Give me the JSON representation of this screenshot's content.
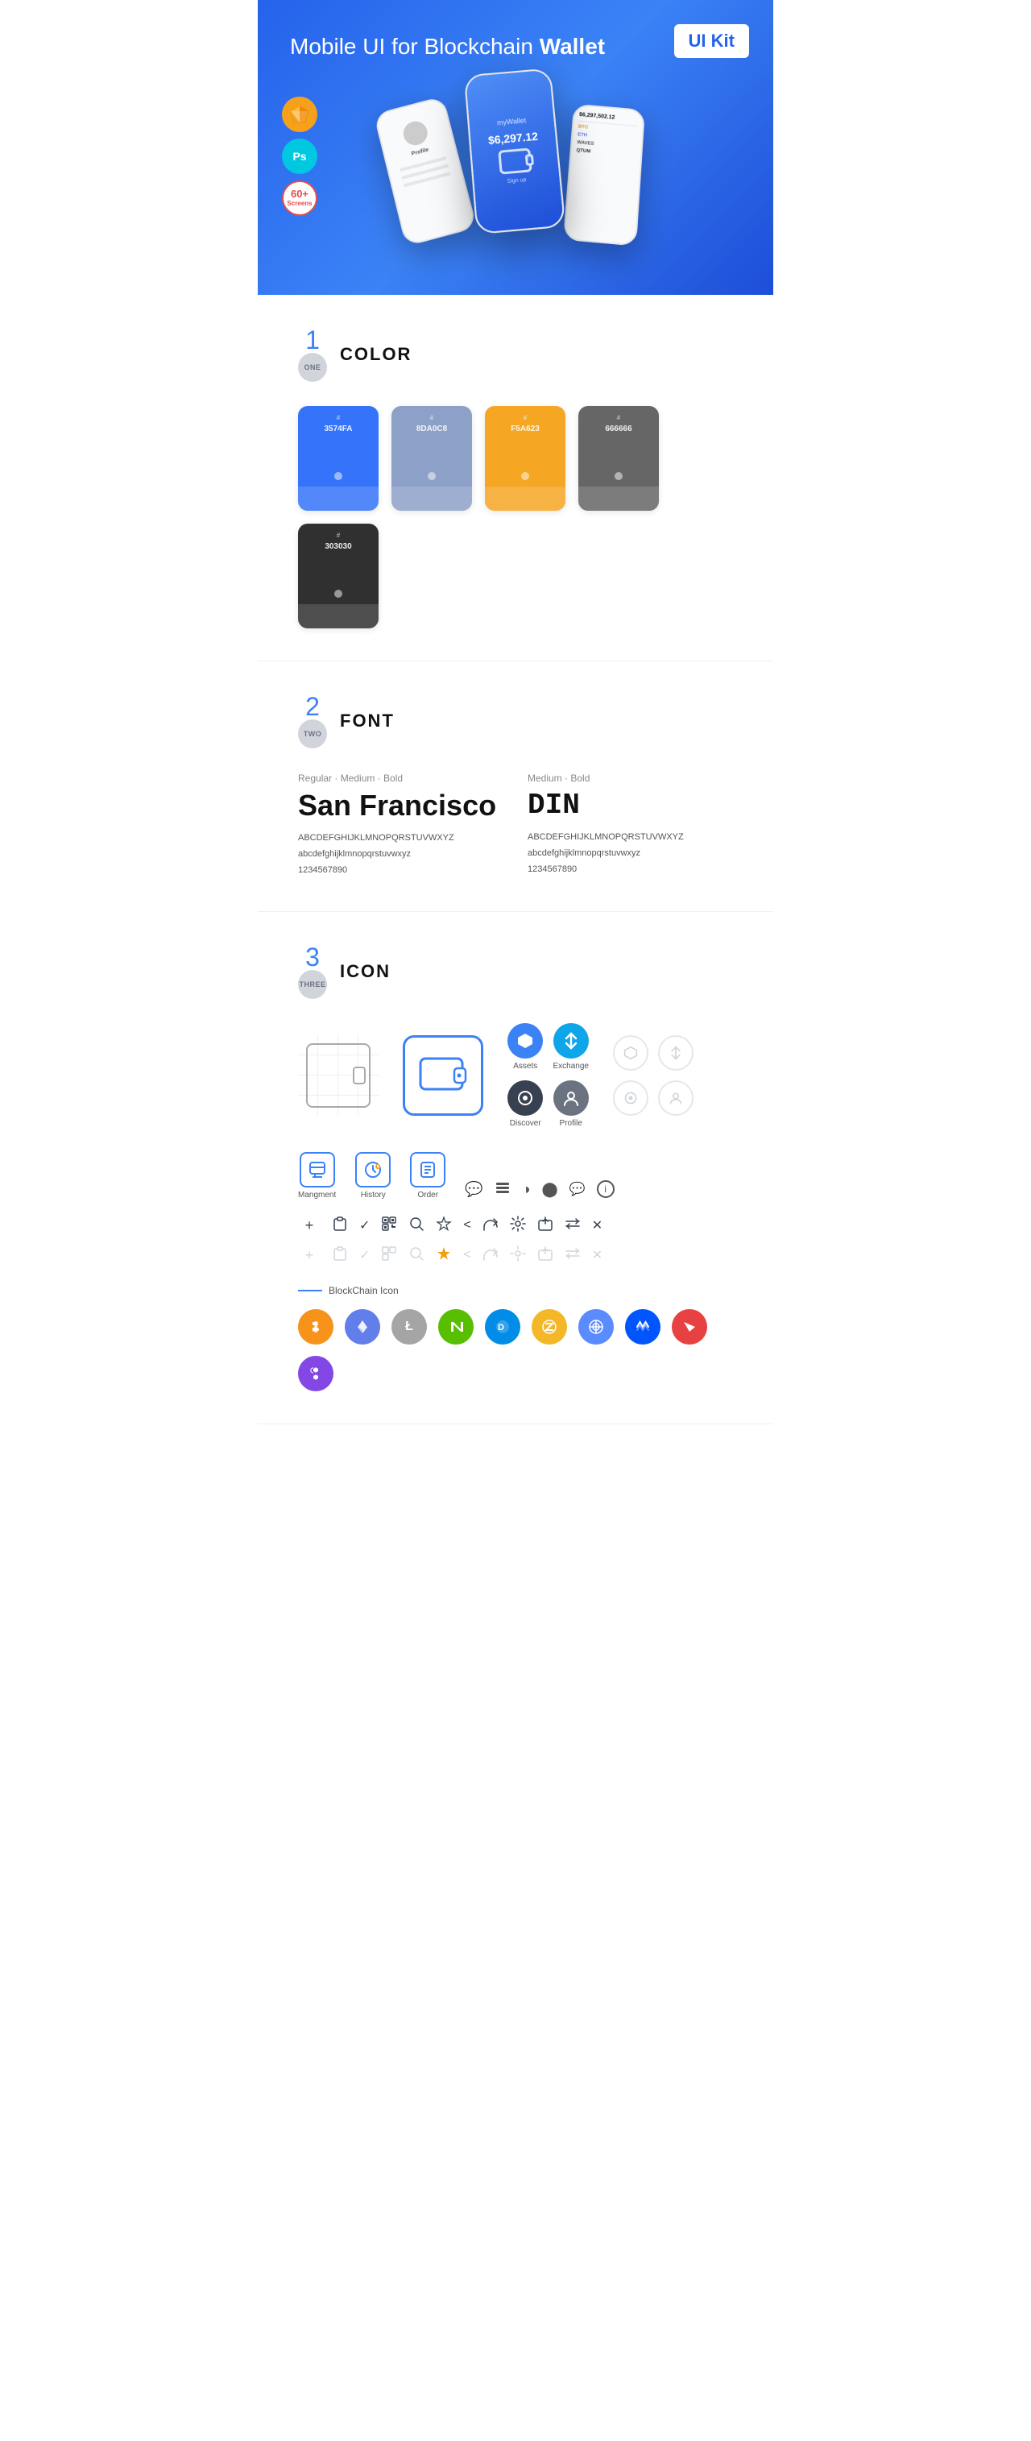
{
  "hero": {
    "title": "Mobile UI for Blockchain ",
    "title_bold": "Wallet",
    "badge": "UI Kit",
    "badges": [
      {
        "id": "sketch",
        "label": "Sketch"
      },
      {
        "id": "ps",
        "label": "Ps"
      },
      {
        "id": "screens",
        "line1": "60+",
        "line2": "Screens"
      }
    ]
  },
  "sections": {
    "color": {
      "number": "1",
      "number_label": "ONE",
      "title": "COLOR",
      "swatches": [
        {
          "hex": "3574FA",
          "color": "#3574FA"
        },
        {
          "hex": "8DA0C8",
          "color": "#8DA0C8"
        },
        {
          "hex": "F5A623",
          "color": "#F5A623"
        },
        {
          "hex": "666666",
          "color": "#666666"
        },
        {
          "hex": "303030",
          "color": "#303030"
        }
      ]
    },
    "font": {
      "number": "2",
      "number_label": "TWO",
      "title": "FONT",
      "fonts": [
        {
          "style": "Regular · Medium · Bold",
          "name": "San Francisco",
          "uppercase": "ABCDEFGHIJKLMNOPQRSTUVWXYZ",
          "lowercase": "abcdefghijklmnopqrstuvwxyz",
          "numbers": "1234567890"
        },
        {
          "style": "Medium · Bold",
          "name": "DIN",
          "uppercase": "ABCDEFGHIJKLMNOPQRSTUVWXYZ",
          "lowercase": "abcdefghijklmnopqrstuvwxyz",
          "numbers": "1234567890"
        }
      ]
    },
    "icon": {
      "number": "3",
      "number_label": "THREE",
      "title": "ICON",
      "app_icons": [
        {
          "label": "Assets",
          "icon": "◆"
        },
        {
          "label": "Exchange",
          "icon": "⇄"
        },
        {
          "label": "Discover",
          "icon": "●"
        },
        {
          "label": "Profile",
          "icon": "◉"
        }
      ],
      "ui_icons": [
        {
          "label": "Mangment",
          "icon": "▣"
        },
        {
          "label": "History",
          "icon": "◷"
        },
        {
          "label": "Order",
          "icon": "≡"
        }
      ],
      "small_icons_row1": [
        "≡",
        "≡",
        "◑",
        "●",
        "▣",
        "ℹ"
      ],
      "small_icons_row2": [
        "+",
        "⊞",
        "✓",
        "⊡",
        "🔍",
        "✩",
        "<",
        "⟨",
        "⚙",
        "⊡",
        "⇄",
        "✕"
      ],
      "small_icons_row3_gray": [
        "+",
        "⊞",
        "✓",
        "⊡",
        "🔍",
        "✩",
        "<",
        "⟨",
        "⚙",
        "⊡",
        "⇄",
        "✕"
      ],
      "blockchain_label": "BlockChain Icon",
      "crypto_icons": [
        {
          "label": "BTC",
          "class": "btc",
          "symbol": "₿"
        },
        {
          "label": "ETH",
          "class": "eth",
          "symbol": "Ξ"
        },
        {
          "label": "LTC",
          "class": "ltc",
          "symbol": "Ł"
        },
        {
          "label": "NEO",
          "class": "neo",
          "symbol": "N"
        },
        {
          "label": "DASH",
          "class": "dash",
          "symbol": "D"
        },
        {
          "label": "ZEC",
          "class": "zcash",
          "symbol": "Z"
        },
        {
          "label": "GRID",
          "class": "grid-crypto",
          "symbol": "G"
        },
        {
          "label": "WAVES",
          "class": "waves",
          "symbol": "W"
        },
        {
          "label": "TRX",
          "class": "tron",
          "symbol": "T"
        },
        {
          "label": "MATIC",
          "class": "polygon",
          "symbol": "M"
        }
      ]
    }
  }
}
